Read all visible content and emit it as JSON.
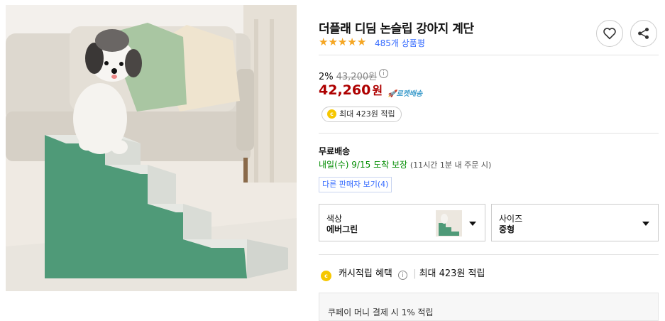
{
  "product": {
    "title": "더플래 디딤 논슬립 강아지 계단",
    "rating_stars": 5,
    "review_count": "485개 상품평",
    "image_alt": "product-photo-dog-on-green-pet-stairs"
  },
  "actions": {
    "wishlist_icon": "heart-icon",
    "share_icon": "share-icon"
  },
  "price": {
    "discount": "2%",
    "original": "43,200원",
    "info_glyph": "i",
    "current_number": "42,260",
    "current_unit": "원",
    "rocket_label": "로켓배송"
  },
  "cash": {
    "pill_text": "최대 423원 적립",
    "coin_letter": "c"
  },
  "shipping": {
    "label": "무료배송",
    "arrival": "내일(수) 9/15",
    "guarantee": "도착 보장",
    "condition": "(11시간 1분 내 주문 시)"
  },
  "seller": {
    "other_sellers": "다른 판매자 보기(4)"
  },
  "options": {
    "color": {
      "label": "색상",
      "value": "에버그린"
    },
    "size": {
      "label": "사이즈",
      "value": "중형"
    }
  },
  "cashback": {
    "label": "캐시적립 혜택",
    "info_glyph": "i",
    "detail": "최대 423원 적립"
  },
  "coupay": {
    "text": "쿠페이 머니 결제 시 1% 적립"
  },
  "colors": {
    "price_red": "#ae0000",
    "link_blue": "#346aff",
    "green": "#008c00",
    "star": "#f5a623",
    "coin": "#f6c700"
  }
}
